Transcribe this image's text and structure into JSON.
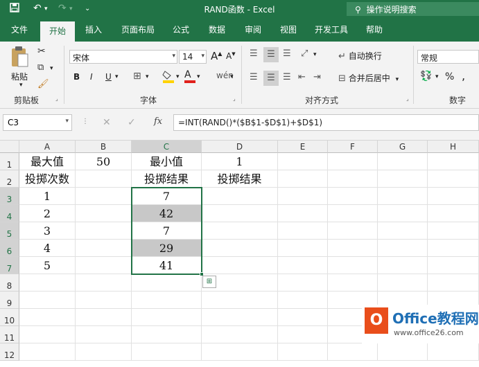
{
  "window": {
    "title": "RAND函数 - Excel",
    "tell_me": "操作说明搜索"
  },
  "icons": {
    "save": "save-icon",
    "undo": "undo-icon",
    "redo": "redo-icon",
    "customize": "qat-dropdown-icon",
    "search": "search-icon",
    "paste": "clipboard-icon",
    "cut": "scissors-icon",
    "copy": "copy-icon",
    "format_painter": "brush-icon",
    "fx": "fx-icon",
    "cancel": "cancel-icon",
    "enter": "check-icon"
  },
  "tabs": [
    "文件",
    "开始",
    "插入",
    "页面布局",
    "公式",
    "数据",
    "审阅",
    "视图",
    "开发工具",
    "帮助"
  ],
  "active_tab": "开始",
  "ribbon": {
    "paste_label": "粘贴",
    "clipboard_group": "剪贴板",
    "font_name": "宋体",
    "font_size": "14",
    "grow_font": "A",
    "shrink_font": "A",
    "bold": "B",
    "italic": "I",
    "underline": "U",
    "font_color_letter": "A",
    "font_group": "字体",
    "wrap_text": "自动换行",
    "merge_center": "合并后居中",
    "alignment_group": "对齐方式",
    "number_format": "常规",
    "percent": "%",
    "comma": ",",
    "number_group": "数字",
    "accent_red": "#e0201b",
    "accent_yellow": "#ffd200"
  },
  "formula_bar": {
    "name_box": "C3",
    "fx_label": "fx",
    "formula": "=INT(RAND()*($B$1-$D$1)+$D$1)"
  },
  "sheet": {
    "columns": [
      "A",
      "B",
      "C",
      "D",
      "E",
      "F",
      "G",
      "H"
    ],
    "rows": [
      "1",
      "2",
      "3",
      "4",
      "5",
      "6",
      "7",
      "8",
      "9",
      "10",
      "11",
      "12"
    ],
    "cells": {
      "A1": "最大值",
      "B1": "50",
      "C1": "最小值",
      "D1": "1",
      "A2": "投掷次数",
      "C2": "投掷结果",
      "D2": "投掷结果",
      "A3": "1",
      "A4": "2",
      "A5": "3",
      "A6": "4",
      "A7": "5",
      "C3": "7",
      "C4": "42",
      "C5": "7",
      "C6": "29",
      "C7": "41"
    },
    "selected_range": "C3:C7"
  },
  "watermark": {
    "brand": "Office教程网",
    "url": "www.office26.com"
  }
}
